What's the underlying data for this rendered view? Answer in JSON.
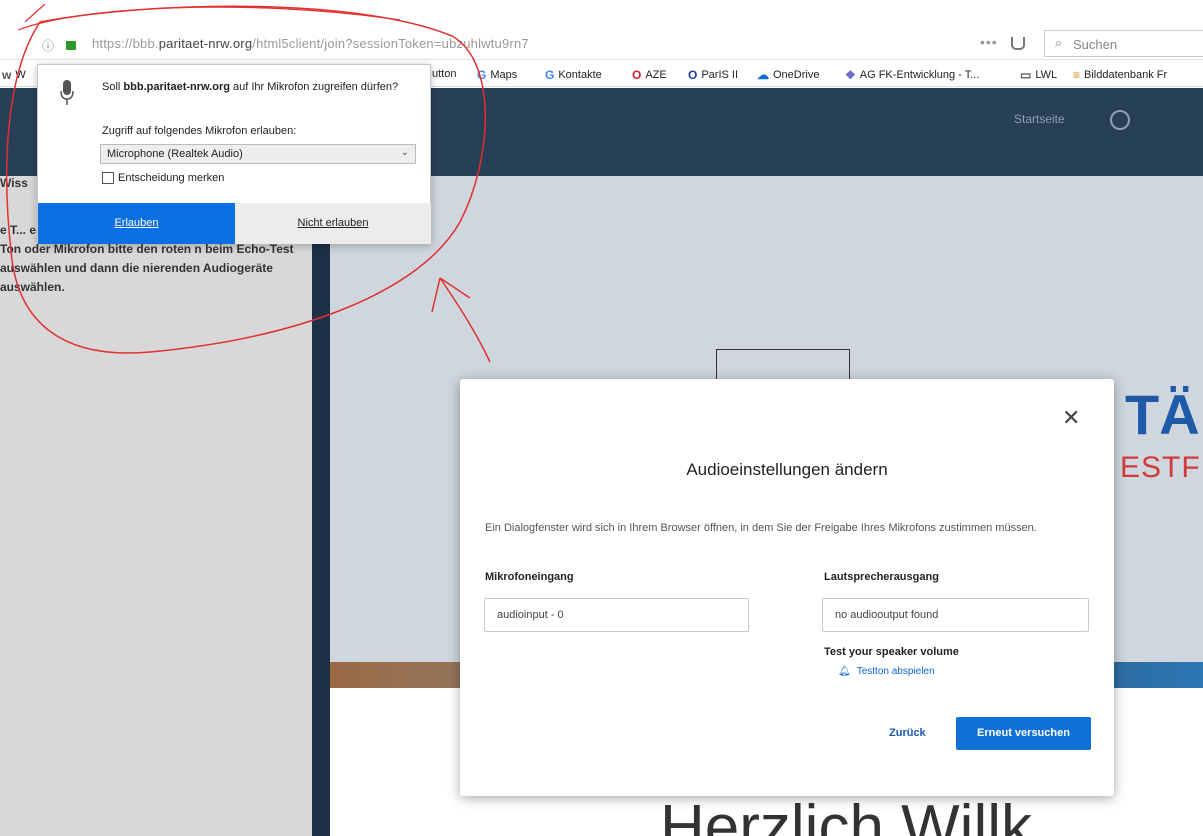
{
  "browser": {
    "url_prefix": "https://bbb.",
    "url_host": "paritaet-nrw.org",
    "url_suffix": "/html5client/join?sessionToken=ubzuhlwtu9rn7",
    "more_dots": "•••",
    "search_placeholder": "Suchen"
  },
  "bookmarks": [
    {
      "icon": "w",
      "label": "W",
      "color": "#555"
    },
    {
      "icon": "",
      "label": "utton",
      "color": "#555"
    },
    {
      "icon": "G",
      "label": "Maps",
      "color": "#4285f4"
    },
    {
      "icon": "G",
      "label": "Kontakte",
      "color": "#4285f4"
    },
    {
      "icon": "O",
      "label": "AZE",
      "color": "#d31f2f"
    },
    {
      "icon": "O",
      "label": "ParIS II",
      "color": "#1a3ea8"
    },
    {
      "icon": "☁",
      "label": "OneDrive",
      "color": "#0f6cd1"
    },
    {
      "icon": "❖",
      "label": "AG FK-Entwicklung - T...",
      "color": "#6b6bd6"
    },
    {
      "icon": "▭",
      "label": "LWL",
      "color": "#555"
    },
    {
      "icon": "≡",
      "label": "Bilddatenbank Fr",
      "color": "#c98c1a"
    }
  ],
  "background_page": {
    "topbar_link": "Startseite",
    "sidebar_lead": "Wiss",
    "sidebar_text": "e T... e den Echo-Test richtig durchführen. Bei dem Ton oder Mikrofon bitte den roten n beim Echo-Test auswählen und dann die nierenden Audiogeräte auswählen.",
    "brand_big": "TÄ",
    "brand_sub": "ESTF",
    "welcome": "Herzlich Willk"
  },
  "permission_prompt": {
    "question_prefix": "Soll ",
    "question_host": "bbb.paritaet-nrw.org",
    "question_suffix": " auf Ihr Mikrofon zugreifen dürfen?",
    "access_label": "Zugriff auf folgendes Mikrofon erlauben:",
    "selected_mic": "Microphone (Realtek Audio)",
    "remember_label": "Entscheidung merken",
    "allow_label": "Erlauben",
    "deny_label": "Nicht erlauben"
  },
  "audio_modal": {
    "title": "Audioeinstellungen ändern",
    "description": "Ein Dialogfenster wird sich in Ihrem Browser öffnen, in dem Sie der Freigabe Ihres Mikrofons zustimmen müssen.",
    "input_label": "Mikrofoneingang",
    "input_value": "audioinput - 0",
    "output_label": "Lautsprecherausgang",
    "output_value": "no audiooutput found",
    "test_label": "Test your speaker volume",
    "play_label": "Testton abspielen",
    "back_label": "Zurück",
    "retry_label": "Erneut versuchen"
  },
  "colors": {
    "allow_blue": "#0a6fe0",
    "retry_blue": "#0f70d6",
    "header_navy": "#273f57",
    "annotation_red": "#e03030"
  }
}
